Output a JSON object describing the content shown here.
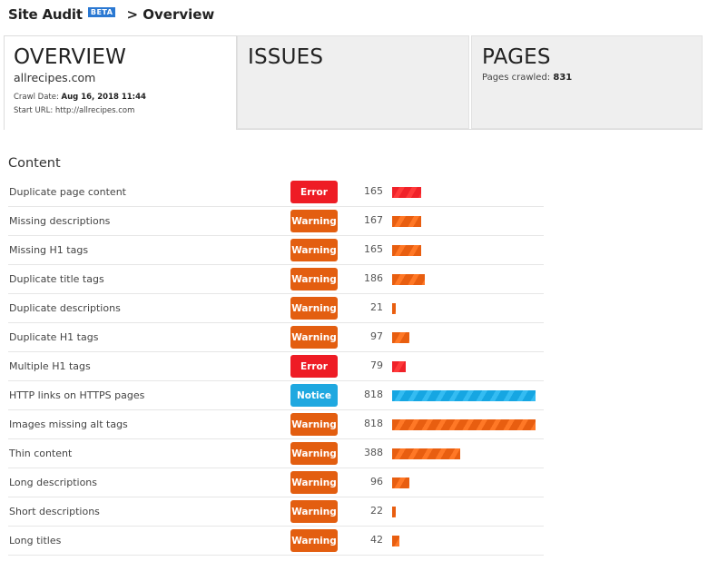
{
  "header": {
    "title": "Site Audit",
    "beta_badge": "BETA",
    "breadcrumb": "> Overview"
  },
  "cards": {
    "overview": {
      "title": "OVERVIEW",
      "domain": "allrecipes.com",
      "crawl_date_label": "Crawl Date:",
      "crawl_date_value": "Aug 16, 2018 11:44",
      "start_url_label": "Start URL:",
      "start_url_value": "http://allrecipes.com"
    },
    "issues": {
      "title": "ISSUES"
    },
    "pages": {
      "title": "PAGES",
      "pages_crawled_label": "Pages crawled:",
      "pages_crawled_value": "831"
    }
  },
  "content": {
    "section_title": "Content",
    "bar_scale_max": 818,
    "colors": {
      "error": "#ee1c25",
      "warning": "#e35e10",
      "notice": "#1fa8e0"
    },
    "rows": [
      {
        "label": "Duplicate page content",
        "severity": "error",
        "badge": "Error",
        "count": 165
      },
      {
        "label": "Missing descriptions",
        "severity": "warning",
        "badge": "Warning",
        "count": 167
      },
      {
        "label": "Missing H1 tags",
        "severity": "warning",
        "badge": "Warning",
        "count": 165
      },
      {
        "label": "Duplicate title tags",
        "severity": "warning",
        "badge": "Warning",
        "count": 186
      },
      {
        "label": "Duplicate descriptions",
        "severity": "warning",
        "badge": "Warning",
        "count": 21
      },
      {
        "label": "Duplicate H1 tags",
        "severity": "warning",
        "badge": "Warning",
        "count": 97
      },
      {
        "label": "Multiple H1 tags",
        "severity": "error",
        "badge": "Error",
        "count": 79
      },
      {
        "label": "HTTP links on HTTPS pages",
        "severity": "notice",
        "badge": "Notice",
        "count": 818
      },
      {
        "label": "Images missing alt tags",
        "severity": "warning",
        "badge": "Warning",
        "count": 818
      },
      {
        "label": "Thin content",
        "severity": "warning",
        "badge": "Warning",
        "count": 388
      },
      {
        "label": "Long descriptions",
        "severity": "warning",
        "badge": "Warning",
        "count": 96
      },
      {
        "label": "Short descriptions",
        "severity": "warning",
        "badge": "Warning",
        "count": 22
      },
      {
        "label": "Long titles",
        "severity": "warning",
        "badge": "Warning",
        "count": 42
      }
    ]
  }
}
